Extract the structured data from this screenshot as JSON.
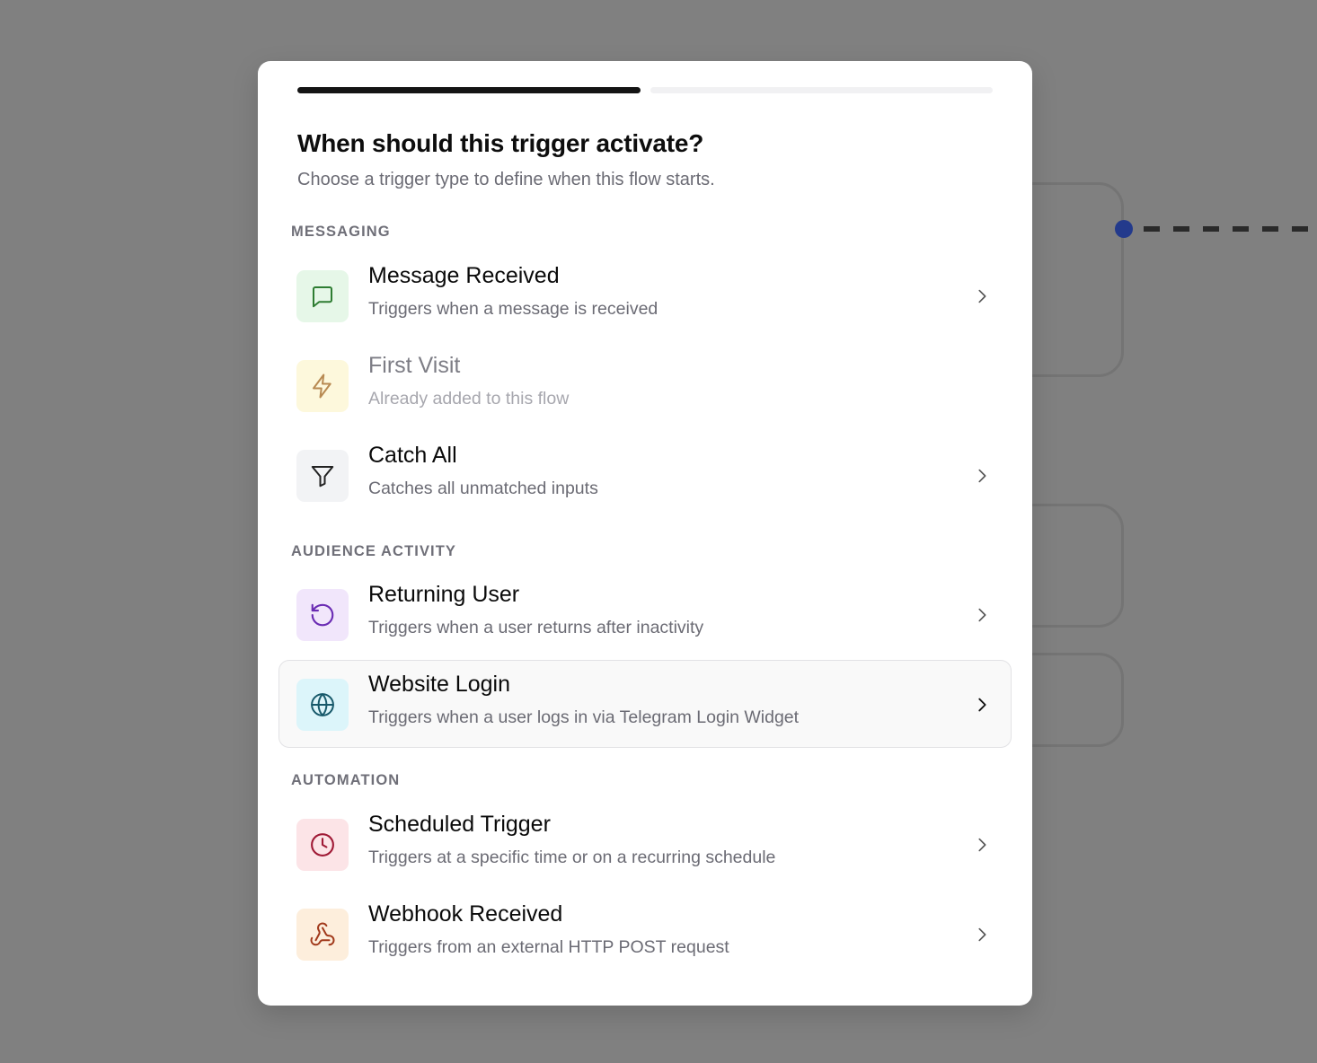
{
  "modal": {
    "progress": {
      "current_step": 1,
      "total_steps": 2
    },
    "title": "When should this trigger activate?",
    "subtitle": "Choose a trigger type to define when this flow starts."
  },
  "sections": [
    {
      "label": "MESSAGING",
      "items": [
        {
          "title": "Message Received",
          "description": "Triggers when a message is received",
          "icon": "message-square-icon",
          "color": "#2e7d32",
          "bg": "#e6f7e8",
          "enabled": true
        },
        {
          "title": "First Visit",
          "description": "Already added to this flow",
          "icon": "zap-icon",
          "color": "#b88a52",
          "bg": "#fdf8dc",
          "enabled": false
        },
        {
          "title": "Catch All",
          "description": "Catches all unmatched inputs",
          "icon": "filter-icon",
          "color": "#222222",
          "bg": "#f2f3f5",
          "enabled": true
        }
      ]
    },
    {
      "label": "AUDIENCE ACTIVITY",
      "items": [
        {
          "title": "Returning User",
          "description": "Triggers when a user returns after inactivity",
          "icon": "rotate-ccw-icon",
          "color": "#6a2bb3",
          "bg": "#f1e6fb",
          "enabled": true
        },
        {
          "title": "Website Login",
          "description": "Triggers when a user logs in via Telegram Login Widget",
          "icon": "globe-icon",
          "color": "#17596a",
          "bg": "#dcf5fa",
          "enabled": true,
          "hovered": true
        }
      ]
    },
    {
      "label": "AUTOMATION",
      "items": [
        {
          "title": "Scheduled Trigger",
          "description": "Triggers at a specific time or on a recurring schedule",
          "icon": "clock-icon",
          "color": "#a01a36",
          "bg": "#fce4e7",
          "enabled": true
        },
        {
          "title": "Webhook Received",
          "description": "Triggers from an external HTTP POST request",
          "icon": "webhook-icon",
          "color": "#a1391b",
          "bg": "#fdeedc",
          "enabled": true
        }
      ]
    }
  ]
}
